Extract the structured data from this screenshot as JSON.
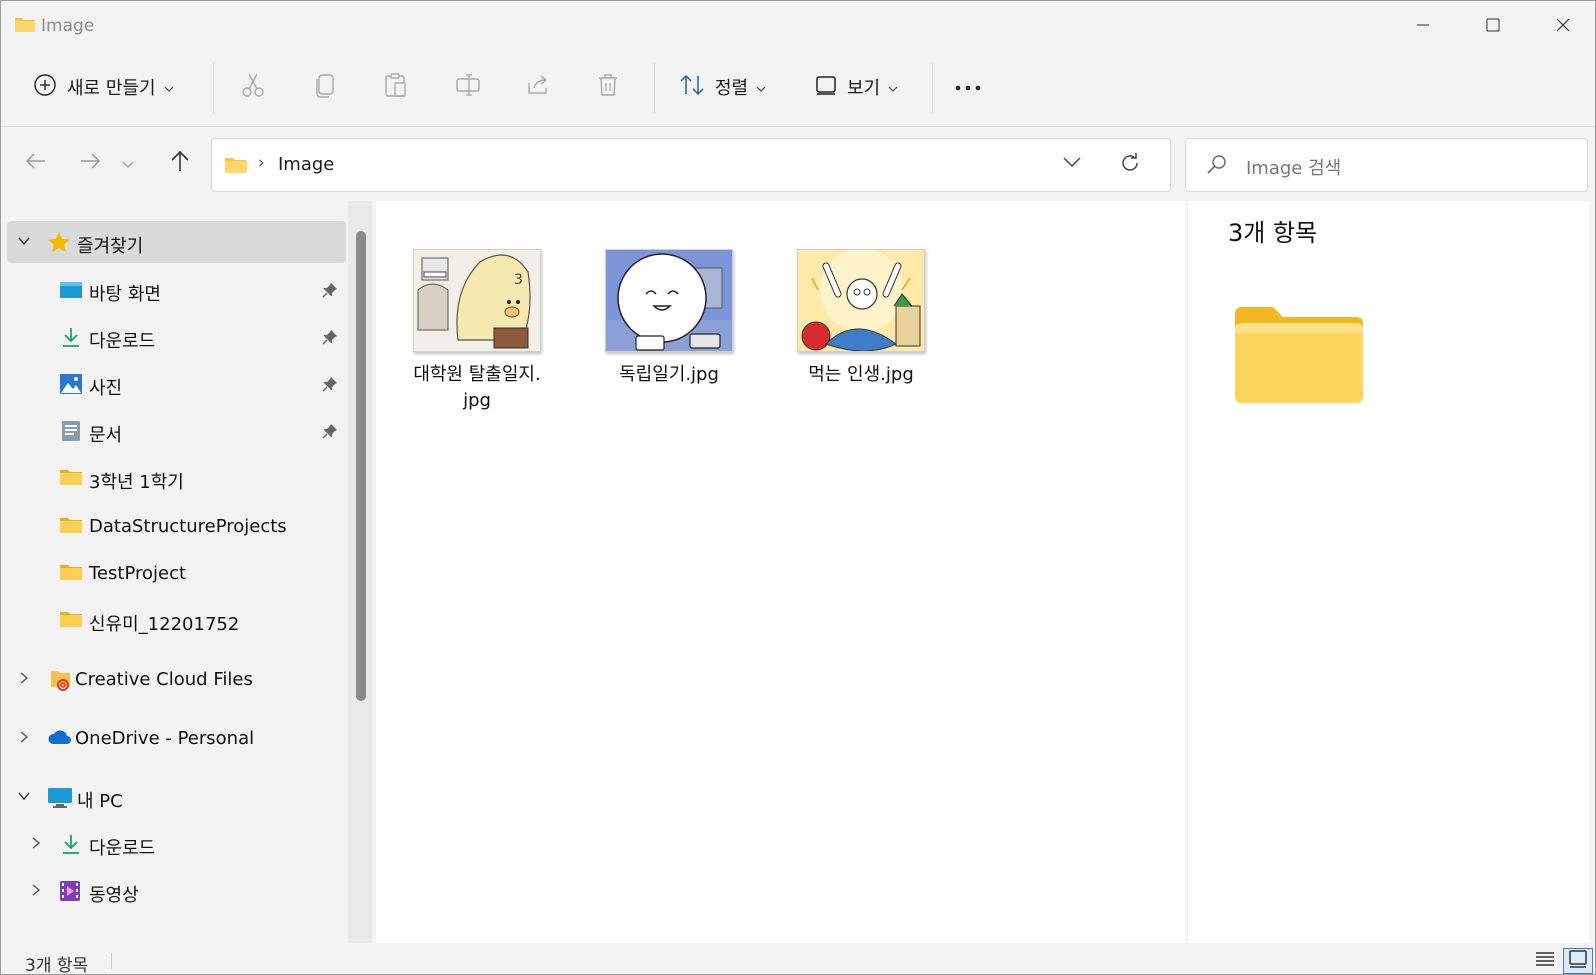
{
  "window": {
    "title": "Image"
  },
  "toolbar": {
    "new_label": "새로 만들기",
    "sort_label": "정렬",
    "view_label": "보기"
  },
  "address": {
    "crumb": "Image"
  },
  "search": {
    "placeholder": "Image 검색"
  },
  "sidebar": {
    "favorites": "즐겨찾기",
    "items": [
      {
        "label": "바탕 화면",
        "icon": "desktop-icon",
        "pinned": true
      },
      {
        "label": "다운로드",
        "icon": "download-icon",
        "pinned": true
      },
      {
        "label": "사진",
        "icon": "pictures-icon",
        "pinned": true
      },
      {
        "label": "문서",
        "icon": "documents-icon",
        "pinned": true
      },
      {
        "label": "3학년 1학기",
        "icon": "folder-icon",
        "pinned": false
      },
      {
        "label": "DataStructureProjects",
        "icon": "folder-icon",
        "pinned": false
      },
      {
        "label": "TestProject",
        "icon": "folder-icon",
        "pinned": false
      },
      {
        "label": "신유미_12201752",
        "icon": "folder-icon",
        "pinned": false
      }
    ],
    "creative_cloud": "Creative Cloud Files",
    "onedrive": "OneDrive - Personal",
    "this_pc": "내 PC",
    "pc_items": [
      {
        "label": "다운로드",
        "icon": "download-icon"
      },
      {
        "label": "동영상",
        "icon": "videos-icon"
      }
    ]
  },
  "files": [
    {
      "name_line1": "대학원 탈출일지.",
      "name_line2": "jpg"
    },
    {
      "name_line1": "독립일기.jpg",
      "name_line2": ""
    },
    {
      "name_line1": "먹는 인생.jpg",
      "name_line2": ""
    }
  ],
  "details": {
    "count": "3개 항목"
  },
  "status": {
    "count": "3개 항목"
  },
  "colors": {
    "folder": "#f6c342",
    "accent": "#3a7bd5",
    "selected": "#dadada"
  }
}
